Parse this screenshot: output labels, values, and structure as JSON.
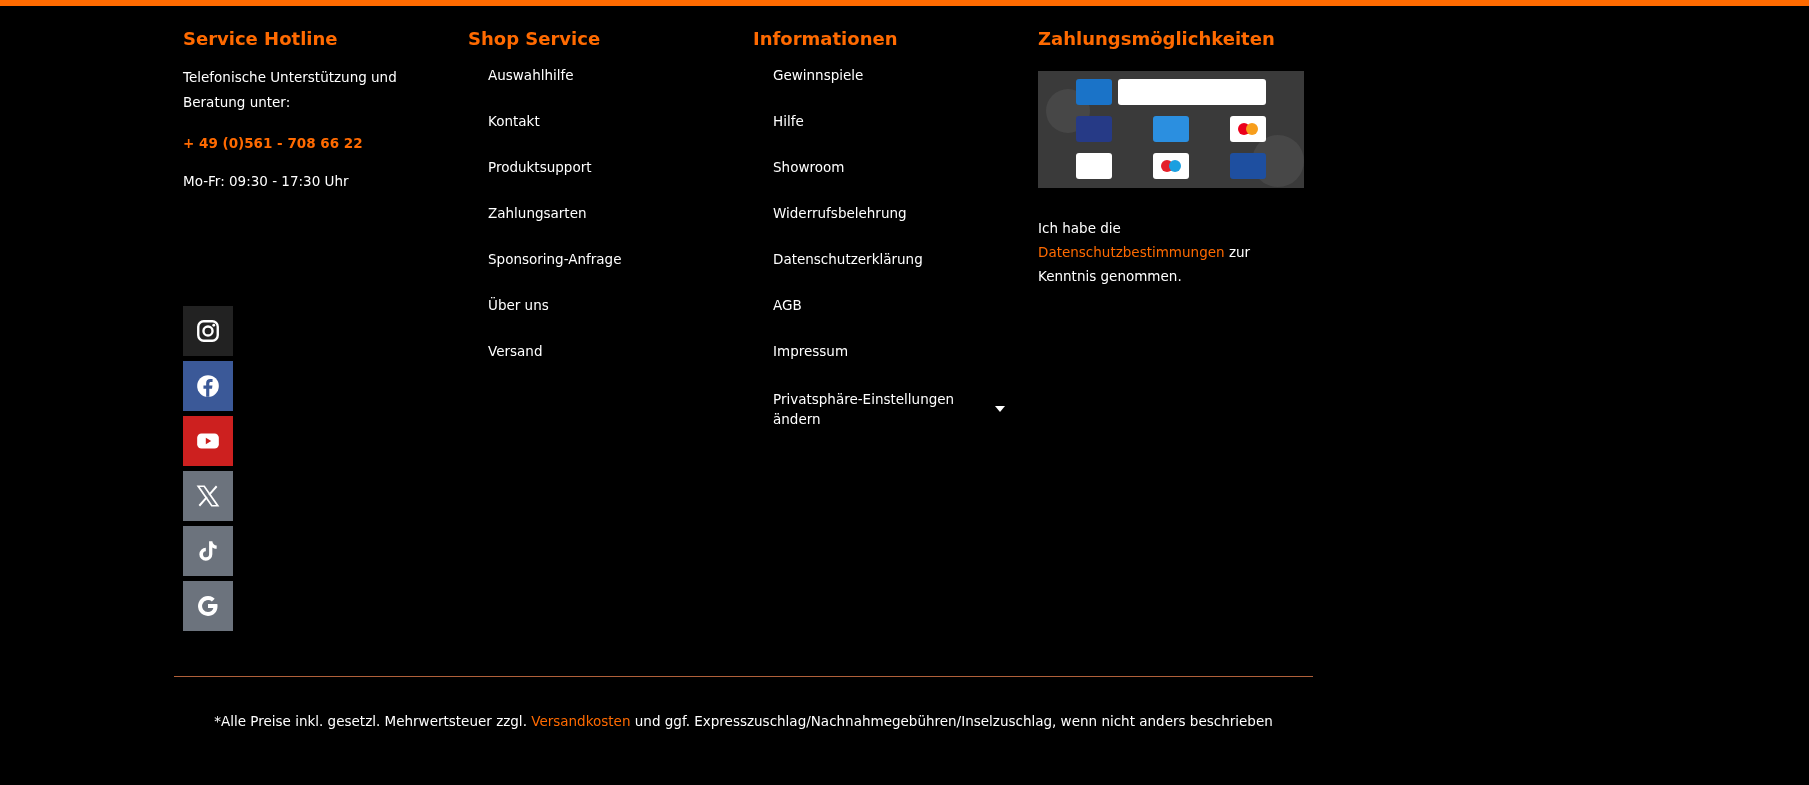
{
  "hotline": {
    "heading": "Service Hotline",
    "text": "Telefonische Unterstützung und Beratung unter:",
    "phone": "+ 49 (0)561 - 708 66 22",
    "hours": "Mo-Fr: 09:30 - 17:30 Uhr"
  },
  "social": [
    {
      "kind": "instagram",
      "color": "#222222"
    },
    {
      "kind": "facebook",
      "color": "#3b5998"
    },
    {
      "kind": "youtube",
      "color": "#cd201f"
    },
    {
      "kind": "x",
      "color": "#6c737d"
    },
    {
      "kind": "tiktok",
      "color": "#6c737d"
    },
    {
      "kind": "google",
      "color": "#6c737d"
    }
  ],
  "shop_service": {
    "heading": "Shop Service",
    "links": [
      {
        "label": "Auswahlhilfe",
        "kind": "link"
      },
      {
        "label": "Kontakt",
        "kind": "link"
      },
      {
        "label": "Produktsupport",
        "kind": "link"
      },
      {
        "label": "Zahlungsarten",
        "kind": "link"
      },
      {
        "label": "Sponsoring-Anfrage",
        "kind": "link"
      },
      {
        "label": "Über uns",
        "kind": "link"
      },
      {
        "label": "Versand",
        "kind": "link"
      }
    ]
  },
  "informationen": {
    "heading": "Informationen",
    "links": [
      {
        "label": "Gewinnspiele",
        "kind": "link"
      },
      {
        "label": "Hilfe",
        "kind": "link"
      },
      {
        "label": "Showroom",
        "kind": "link"
      },
      {
        "label": "Widerrufsbelehrung",
        "kind": "link"
      },
      {
        "label": "Datenschutzerklärung",
        "kind": "link"
      },
      {
        "label": "AGB",
        "kind": "link"
      },
      {
        "label": "Impressum",
        "kind": "link"
      },
      {
        "label": "Privatsphäre-Einstellungen ändern",
        "kind": "dropdown"
      }
    ]
  },
  "payment": {
    "heading": "Zahlungsmöglichkeiten",
    "consent": {
      "before": "Ich habe die",
      "link": "Datenschutzbestimmungen",
      "after": "zur Kenntnis genommen."
    }
  },
  "note": {
    "before": "*Alle Preise inkl. gesetzl. Mehrwertsteuer zzgl.",
    "link": "Versandkosten",
    "after": "und ggf. Expresszuschlag/Nachnahmegebühren/Inselzuschlag, wenn nicht anders beschrieben"
  }
}
